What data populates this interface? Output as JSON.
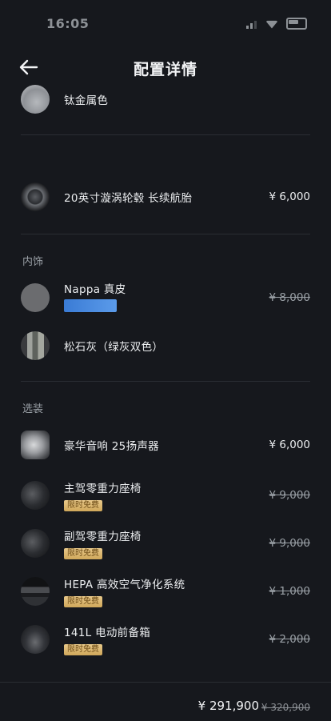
{
  "status": {
    "time": "16:05"
  },
  "header": {
    "title": "配置详情"
  },
  "paint": {
    "label": "钛金属色"
  },
  "wheels": {
    "section_title": "",
    "label": "20英寸漩涡轮毂 长续航胎",
    "price": "¥ 6,000"
  },
  "interior": {
    "section_title": "内饰",
    "items": [
      {
        "label": "Nappa 真皮",
        "price": "¥ 8,000"
      },
      {
        "label": "松石灰（绿灰双色）",
        "price": ""
      }
    ]
  },
  "options": {
    "section_title": "选装",
    "items": [
      {
        "label": "豪华音响 25扬声器",
        "price": "¥ 6,000",
        "badge": ""
      },
      {
        "label": "主驾零重力座椅",
        "price": "¥ 9,000",
        "badge": "限时免费"
      },
      {
        "label": "副驾零重力座椅",
        "price": "¥ 9,000",
        "badge": "限时免费"
      },
      {
        "label": "HEPA 高效空气净化系统",
        "price": "¥ 1,000",
        "badge": "限时免费"
      },
      {
        "label": "141L 电动前备箱",
        "price": "¥ 2,000",
        "badge": "限时免费"
      }
    ]
  },
  "footer": {
    "total": "¥ 291,900",
    "original": "¥ 320,900"
  },
  "colors": {
    "background": "#16181d",
    "badge_gold": "#dcb36b"
  },
  "icons": {
    "back": "arrow-left-icon"
  }
}
